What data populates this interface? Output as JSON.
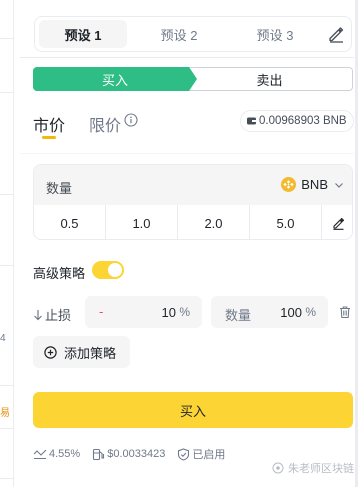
{
  "presets": {
    "tabs": [
      {
        "label": "预设 1",
        "active": true
      },
      {
        "label": "预设 2",
        "active": false
      },
      {
        "label": "预设 3",
        "active": false
      }
    ],
    "edit_icon": "pencil-icon"
  },
  "side": {
    "buy_label": "买入",
    "sell_label": "卖出",
    "selected": "buy"
  },
  "order_type": {
    "market_label": "市价",
    "limit_label": "限价",
    "selected": "market"
  },
  "balance": {
    "text": "0.00968903 BNB"
  },
  "quantity": {
    "label": "数量",
    "asset": "BNB",
    "presets": [
      "0.5",
      "1.0",
      "2.0",
      "5.0"
    ]
  },
  "advanced": {
    "label": "高级策略",
    "enabled": true
  },
  "stop_loss": {
    "label": "止损",
    "sign": "-",
    "percent": "10",
    "percent_unit": "%",
    "amount_label": "数量",
    "amount": "100",
    "amount_unit": "%"
  },
  "add_strategy_label": "添加策略",
  "buy_button_label": "买入",
  "footer": {
    "slippage": "4.55%",
    "gas": "$0.0033423",
    "mev": "已启用"
  },
  "watermark": "朱老师区块链",
  "left_fragments": [
    "4",
    "易"
  ],
  "colors": {
    "buy": "#2ebd85",
    "accent": "#fcd535",
    "underline": "#f0b90b",
    "negative": "#f6465d",
    "bnb": "#f3ba2f"
  }
}
